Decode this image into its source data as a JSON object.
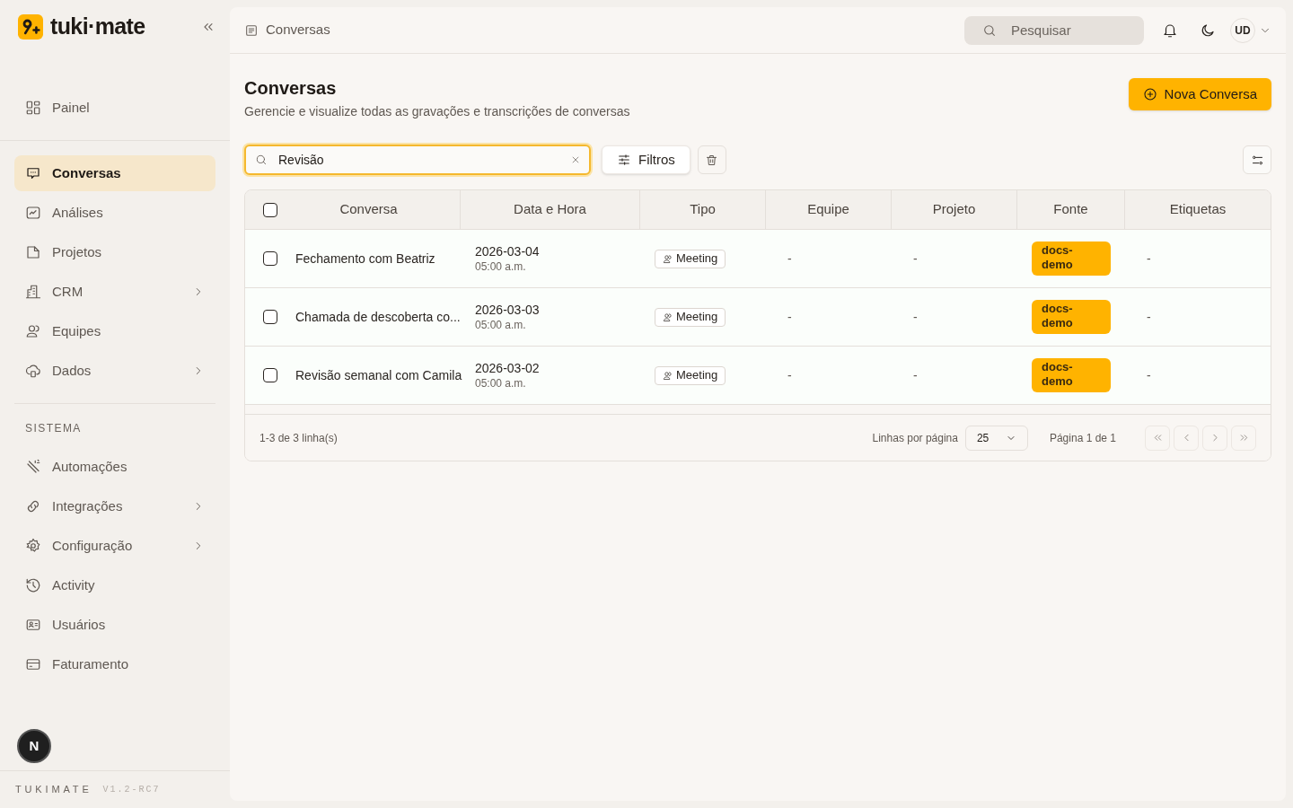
{
  "brand": {
    "name": "tuki·mate"
  },
  "sidebar": {
    "top_items": [
      {
        "label": "Painel",
        "selected": false,
        "expandable": false
      }
    ],
    "main_items": [
      {
        "label": "Conversas",
        "selected": true,
        "expandable": false
      },
      {
        "label": "Análises",
        "selected": false,
        "expandable": false
      },
      {
        "label": "Projetos",
        "selected": false,
        "expandable": false
      },
      {
        "label": "CRM",
        "selected": false,
        "expandable": true
      },
      {
        "label": "Equipes",
        "selected": false,
        "expandable": false
      },
      {
        "label": "Dados",
        "selected": false,
        "expandable": true
      }
    ],
    "system_heading": "SISTEMA",
    "system_items": [
      {
        "label": "Automações",
        "selected": false,
        "expandable": false
      },
      {
        "label": "Integrações",
        "selected": false,
        "expandable": true
      },
      {
        "label": "Configuração",
        "selected": false,
        "expandable": true
      },
      {
        "label": "Activity",
        "selected": false,
        "expandable": false
      },
      {
        "label": "Usuários",
        "selected": false,
        "expandable": false
      },
      {
        "label": "Faturamento",
        "selected": false,
        "expandable": false
      }
    ],
    "badge": "N",
    "footer_name": "TUKIMATE",
    "footer_version": "V1.2-RC7"
  },
  "header": {
    "breadcrumb": "Conversas",
    "search": {
      "placeholder": "Pesquisar"
    },
    "avatar": "UD"
  },
  "page": {
    "title": "Conversas",
    "subtitle": "Gerencie e visualize todas as gravações e transcrições de conversas",
    "new_button": "Nova Conversa"
  },
  "toolbar": {
    "search": {
      "value": "Revisão"
    },
    "filters_button": "Filtros"
  },
  "table": {
    "columns": [
      "Conversa",
      "Data e Hora",
      "Tipo",
      "Equipe",
      "Projeto",
      "Fonte",
      "Etiquetas"
    ],
    "rows": [
      {
        "checked": false,
        "title": "Fechamento com Beatriz",
        "date": "2026-03-04",
        "time": "05:00 a.m.",
        "type": "Meeting",
        "team": "-",
        "project": "-",
        "source": "docs-demo",
        "tags": "-"
      },
      {
        "checked": false,
        "title": "Chamada de descoberta co...",
        "date": "2026-03-03",
        "time": "05:00 a.m.",
        "type": "Meeting",
        "team": "-",
        "project": "-",
        "source": "docs-demo",
        "tags": "-"
      },
      {
        "checked": false,
        "title": "Revisão semanal com Camila",
        "date": "2026-03-02",
        "time": "05:00 a.m.",
        "type": "Meeting",
        "team": "-",
        "project": "-",
        "source": "docs-demo",
        "tags": "-"
      }
    ],
    "header_checked": false
  },
  "pagination": {
    "summary": "1-3 de 3 linha(s)",
    "rows_per_page_label": "Linhas por página",
    "rows_per_page": "25",
    "page": "Página 1 de 1"
  }
}
